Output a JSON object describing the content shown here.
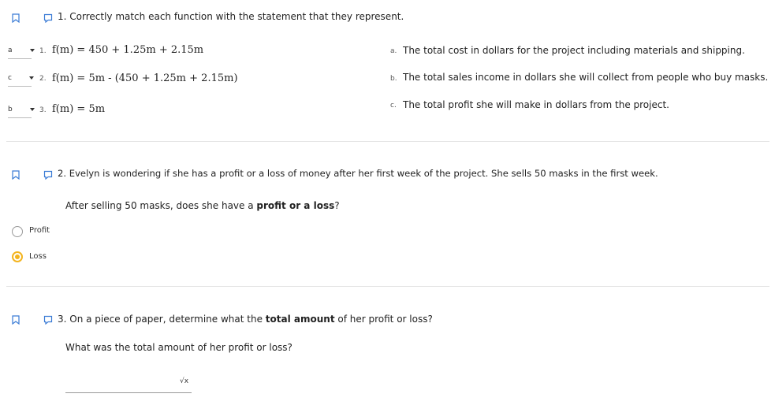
{
  "questions": {
    "q1": {
      "title": "1. Correctly match each function with the statement that they represent.",
      "items": [
        {
          "selected": "a",
          "number": "1.",
          "formula": "f(m) = 450 + 1.25m + 2.15m"
        },
        {
          "selected": "c",
          "number": "2.",
          "formula": "f(m) = 5m - (450 + 1.25m + 2.15m)"
        },
        {
          "selected": "b",
          "number": "3.",
          "formula": "f(m) = 5m"
        }
      ],
      "statements": [
        {
          "letter": "a.",
          "text": "The total cost in dollars for the project including materials and shipping."
        },
        {
          "letter": "b.",
          "text": "The total sales income in dollars she will collect from people who buy masks."
        },
        {
          "letter": "c.",
          "text": "The total profit she will make in dollars from the project."
        }
      ]
    },
    "q2": {
      "title": "2. Evelyn is wondering if she has a profit or a loss of money after her first week of the project. She sells 50 masks in the first week.",
      "prompt_prefix": "After selling 50 masks, does she have a ",
      "prompt_bold": "profit or a loss",
      "prompt_suffix": "?",
      "options": [
        {
          "label": "Profit",
          "selected": false
        },
        {
          "label": "Loss",
          "selected": true
        }
      ]
    },
    "q3": {
      "title_prefix": "3. On a piece of paper, determine what the ",
      "title_bold": "total amount",
      "title_suffix": " of her profit or loss?",
      "prompt": "What was the total amount of her profit or loss?",
      "math_icon_glyph": "√x",
      "answer_value": ""
    }
  },
  "colors": {
    "bookmark": "#3a7bd5",
    "radio_selected": "#f3b41f",
    "divider": "#e3e3e3"
  },
  "icons": {
    "bookmark": "bookmark-icon",
    "comment": "comment-icon",
    "dropdown": "chevron-down-icon",
    "math": "math-editor-icon"
  }
}
